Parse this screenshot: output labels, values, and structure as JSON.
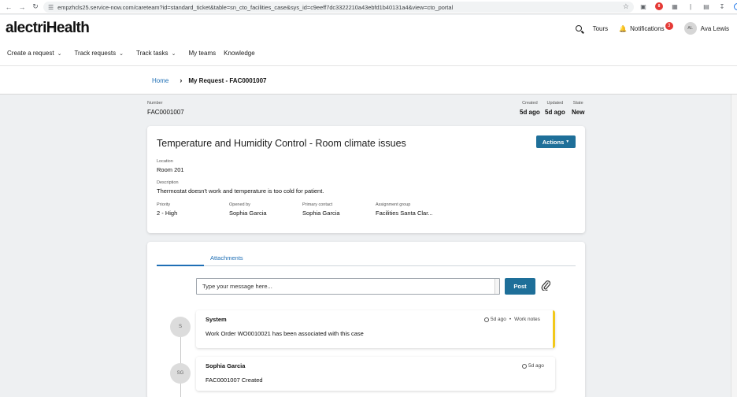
{
  "browser": {
    "url": "empzhcls25.service-now.com/careteam?id=standard_ticket&table=sn_cto_facilities_case&sys_id=c9eeff7dc3322210a43ebfd1b40131a4&view=cto_portal",
    "ext_badge": "8"
  },
  "header": {
    "brand": "alectriHealth",
    "tours": "Tours",
    "notifications": "Notifications",
    "notif_count": "3",
    "user_initials": "AL",
    "user_name": "Ava Lewis"
  },
  "nav": {
    "items": [
      "Create a request",
      "Track requests",
      "Track tasks",
      "My teams",
      "Knowledge"
    ]
  },
  "breadcrumb": {
    "home": "Home",
    "current": "My Request - FAC0001007"
  },
  "record": {
    "number_label": "Number",
    "number": "FAC0001007",
    "created_label": "Created",
    "created": "5d ago",
    "updated_label": "Updated",
    "updated": "5d ago",
    "state_label": "State",
    "state": "New"
  },
  "case": {
    "title": "Temperature and Humidity Control - Room climate issues",
    "actions_label": "Actions",
    "location_label": "Location",
    "location": "Room 201",
    "description_label": "Description",
    "description": "Thermostat doesn't work and temperature is too cold for patient.",
    "priority_label": "Priority",
    "priority": "2 - High",
    "opened_by_label": "Opened by",
    "opened_by": "Sophia Garcia",
    "primary_contact_label": "Primary contact",
    "primary_contact": "Sophia Garcia",
    "assignment_group_label": "Assignment group",
    "assignment_group": "Facilities Santa Clar..."
  },
  "stream": {
    "tab_attachments": "Attachments",
    "message_placeholder": "Type your message here...",
    "post_label": "Post",
    "entries": [
      {
        "initials": "S",
        "author": "System",
        "time": "5d ago",
        "tag": "Work notes",
        "text": "Work Order WO0010021 has been associated with this case"
      },
      {
        "initials": "SG",
        "author": "Sophia Garcia",
        "time": "5d ago",
        "text": "FAC0001007 Created"
      }
    ]
  },
  "colors": {
    "accent": "#1e6f99",
    "link": "#1f6fb5",
    "work_note": "#f2c81a",
    "badge": "#e53935"
  }
}
